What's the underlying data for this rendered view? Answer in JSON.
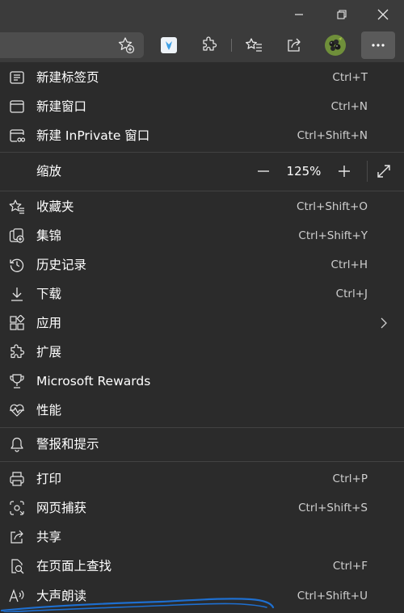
{
  "menu": {
    "new_tab": {
      "label": "新建标签页",
      "shortcut": "Ctrl+T"
    },
    "new_window": {
      "label": "新建窗口",
      "shortcut": "Ctrl+N"
    },
    "new_inprivate": {
      "label": "新建 InPrivate 窗口",
      "shortcut": "Ctrl+Shift+N"
    },
    "zoom": {
      "label": "缩放",
      "value": "125%"
    },
    "favorites": {
      "label": "收藏夹",
      "shortcut": "Ctrl+Shift+O"
    },
    "collections": {
      "label": "集锦",
      "shortcut": "Ctrl+Shift+Y"
    },
    "history": {
      "label": "历史记录",
      "shortcut": "Ctrl+H"
    },
    "downloads": {
      "label": "下载",
      "shortcut": "Ctrl+J"
    },
    "apps": {
      "label": "应用"
    },
    "extensions": {
      "label": "扩展"
    },
    "rewards": {
      "label": "Microsoft Rewards"
    },
    "performance": {
      "label": "性能"
    },
    "alerts": {
      "label": "警报和提示"
    },
    "print": {
      "label": "打印",
      "shortcut": "Ctrl+P"
    },
    "web_capture": {
      "label": "网页捕获",
      "shortcut": "Ctrl+Shift+S"
    },
    "share": {
      "label": "共享"
    },
    "find": {
      "label": "在页面上查找",
      "shortcut": "Ctrl+F"
    },
    "read_aloud": {
      "label": "大声朗读",
      "shortcut": "Ctrl+Shift+U"
    }
  },
  "colors": {
    "background": "#2b2b2b",
    "toolbar": "#3b3b3b",
    "annotation": "#1e6fd0"
  }
}
